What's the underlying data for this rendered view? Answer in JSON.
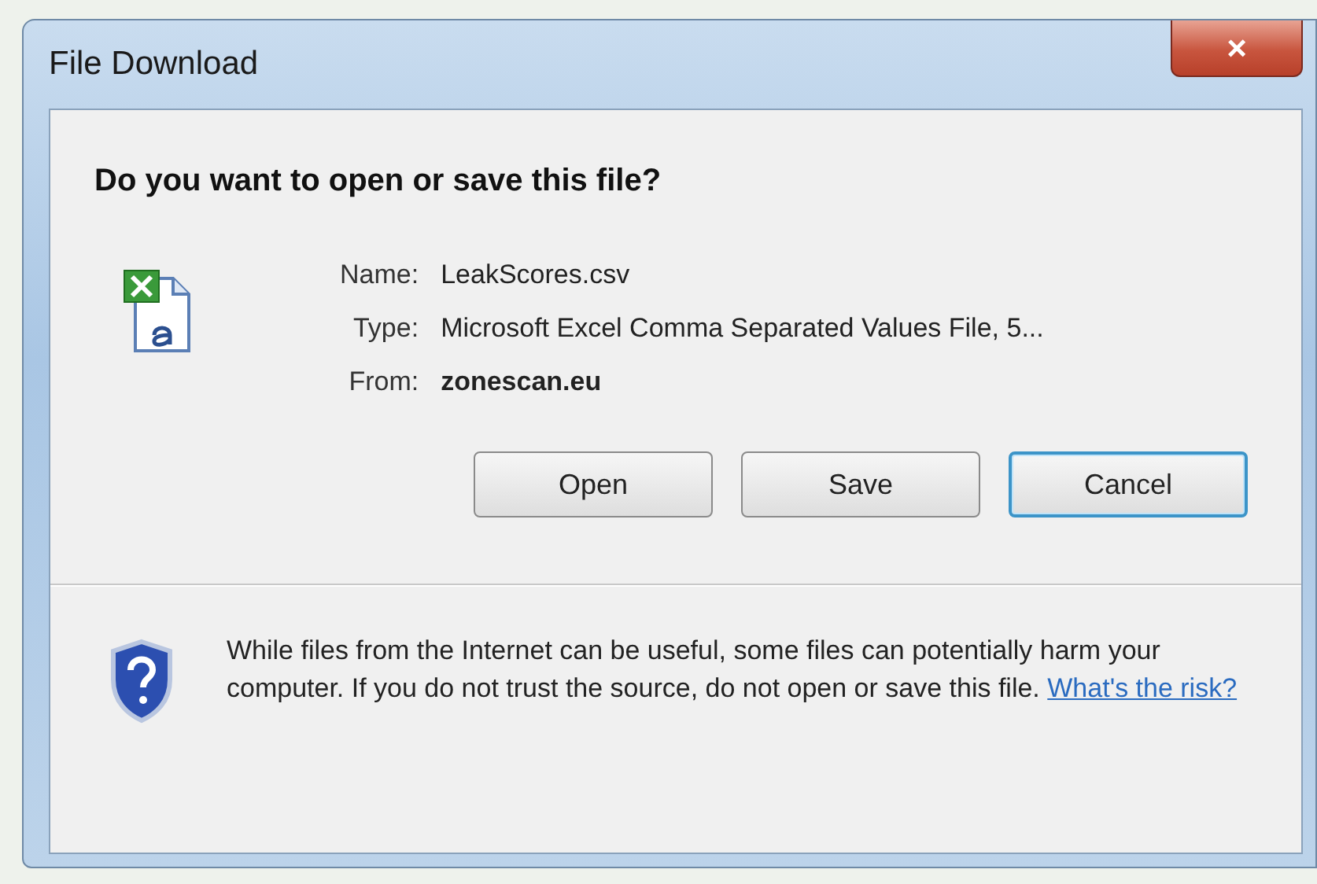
{
  "window": {
    "title": "File Download",
    "close_glyph": "×"
  },
  "heading": "Do you want to open or save this file?",
  "details": [
    {
      "label": "Name:",
      "value": "LeakScores.csv",
      "bold": false
    },
    {
      "label": "Type:",
      "value": "Microsoft Excel Comma Separated Values File, 5...",
      "bold": false
    },
    {
      "label": "From:",
      "value": "zonescan.eu",
      "bold": true
    }
  ],
  "buttons": [
    {
      "label": "Open",
      "default": false
    },
    {
      "label": "Save",
      "default": false
    },
    {
      "label": "Cancel",
      "default": true
    }
  ],
  "warning": {
    "text": "While files from the Internet can be useful, some files can potentially harm your computer. If you do not trust the source, do not open or save this file.",
    "link": "What's the risk?"
  }
}
